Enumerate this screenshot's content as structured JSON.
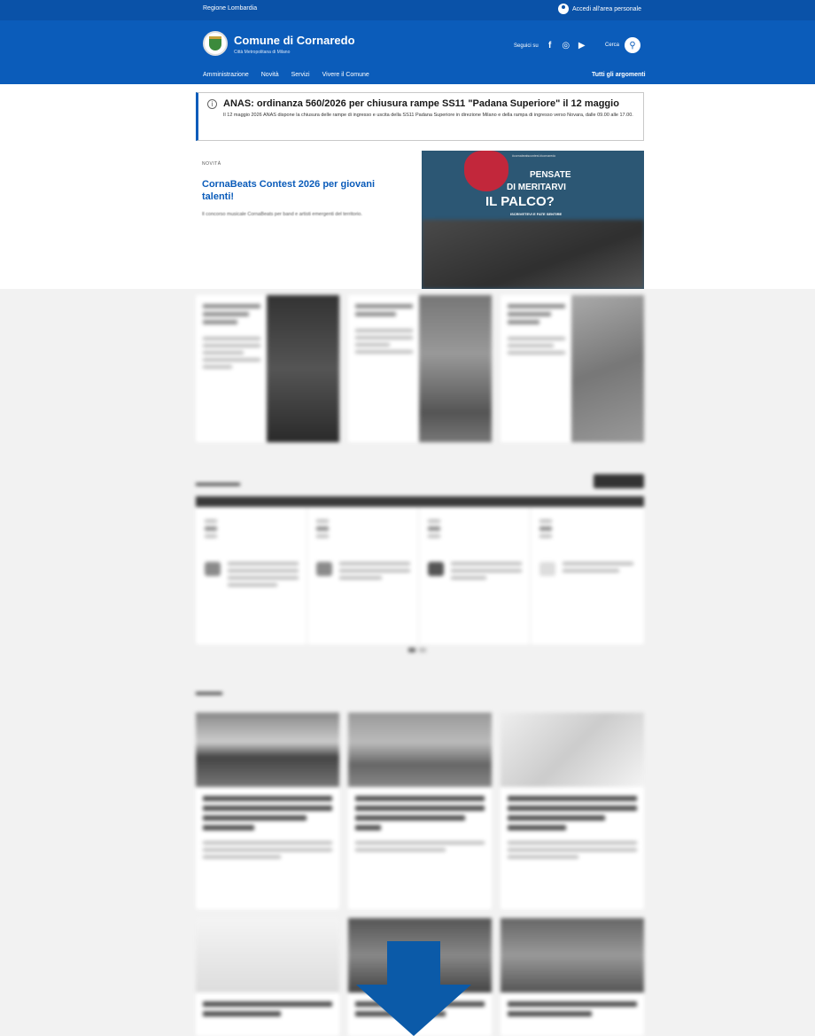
{
  "header": {
    "region": "Regione Lombardia",
    "login": "Accedi all'area personale",
    "brand_name": "Comune di Cornaredo",
    "brand_sub": "Città Metropolitana di Milano",
    "follow_label": "Seguici su",
    "search_label": "Cerca",
    "nav": [
      "Amministrazione",
      "Novità",
      "Servizi",
      "Vivere il Comune"
    ],
    "all_topics": "Tutti gli argomenti"
  },
  "alert": {
    "title": "ANAS: ordinanza 560/2026 per chiusura rampe SS11 \"Padana Superiore\" il 12 maggio",
    "body": "Il 12 maggio 2026 ANAS dispone la chiusura delle rampe di ingresso e uscita della SS11 Padana Superiore in direzione Milano e della rampa di ingresso verso Novara, dalle 09.00 alle 17.00."
  },
  "hero": {
    "label": "NOVITÀ",
    "title": "CornaBeats Contest 2026 per giovani talenti!",
    "desc": "Il concorso musicale CornaBeats per band e artisti emergenti del territorio."
  },
  "poster": {
    "topline": "#cornabeatscontest   #cornaredo",
    "line1": "PENSATE",
    "line2": "DI MERITARVI",
    "line3": "IL PALCO?",
    "line4": "ISCRIVETEVI E FATE SENTIRE"
  },
  "colors": {
    "primary_blue": "#0b5cba",
    "slim_blue": "#0a52a8",
    "arrow_blue": "#0b5aa8",
    "grey_band": "#f2f2f2"
  }
}
